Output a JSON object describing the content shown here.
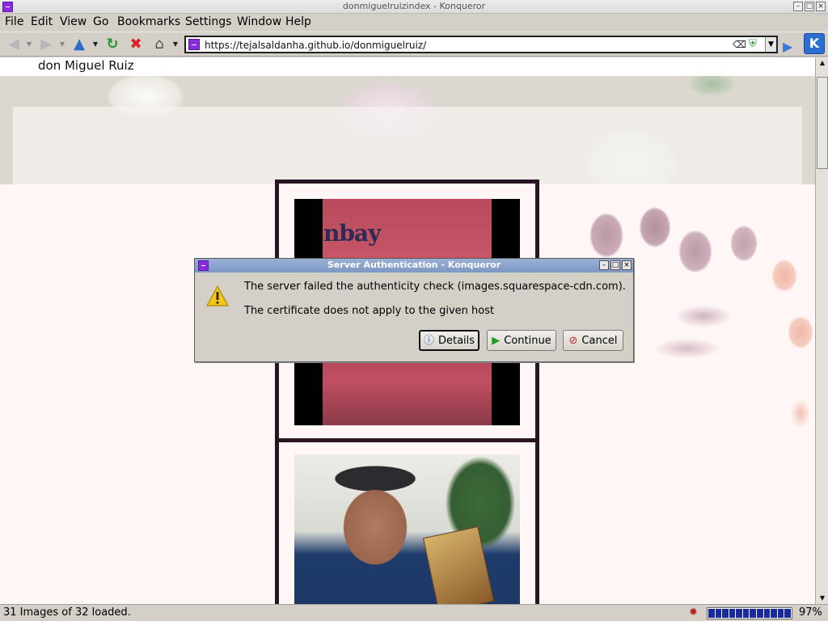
{
  "window": {
    "title": "donmiguelruizindex - Konqueror",
    "controls": [
      "minimize",
      "restore",
      "close"
    ]
  },
  "menu": {
    "file": "File",
    "edit": "Edit",
    "view": "View",
    "go": "Go",
    "bookmarks": "Bookmarks",
    "settings": "Settings",
    "window": "Window",
    "help": "Help"
  },
  "toolbar": {
    "url": "https://tejalsaldanha.github.io/donmiguelruiz/",
    "icons": [
      "back-arrow-icon",
      "forward-arrow-icon",
      "up-arrow-icon",
      "reload-icon",
      "stop-icon",
      "home-icon",
      "clear-url-icon",
      "security-shield-icon",
      "go-arrow-icon",
      "kde-logo-icon"
    ]
  },
  "page": {
    "site_title": "don Miguel Ruiz",
    "card1_image_text": "nbay"
  },
  "dialog": {
    "title": "Server Authentication - Konqueror",
    "message1": "The server failed the authenticity check (images.squarespace-cdn.com).",
    "message2": "The certificate does not apply to the given host",
    "buttons": {
      "details": "Details",
      "continue": "Continue",
      "cancel": "Cancel"
    }
  },
  "status": {
    "text": "31 Images of 32 loaded.",
    "progress": 0.97,
    "percent": "97%"
  }
}
